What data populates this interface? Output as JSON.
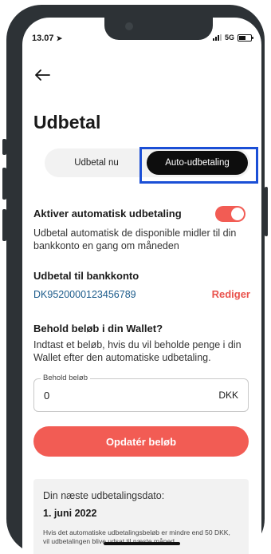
{
  "status_bar": {
    "time": "13.07",
    "network": "5G"
  },
  "page": {
    "title": "Udbetal"
  },
  "tabs": [
    {
      "label": "Udbetal nu",
      "selected": false
    },
    {
      "label": "Auto-udbetaling",
      "selected": true
    }
  ],
  "auto_payout": {
    "label": "Aktiver automatisk udbetaling",
    "enabled": true,
    "description": "Udbetal automatisk de disponible midler til din bankkonto en gang om måneden"
  },
  "bank": {
    "heading": "Udbetal til bankkonto",
    "account": "DK9520000123456789",
    "edit_label": "Rediger"
  },
  "keep": {
    "heading": "Behold beløb i din Wallet?",
    "description": "Indtast et beløb, hvis du vil beholde penge i din Wallet efter den automatiske udbetaling.",
    "field_label": "Behold beløb",
    "value": "0",
    "currency": "DKK",
    "button_label": "Opdatér beløb"
  },
  "next_payout": {
    "title": "Din næste udbetalingsdato:",
    "date": "1. juni 2022",
    "note": "Hvis det automatiske udbetalingsbeløb er mindre end 50 DKK, vil udbetalingen blive udsat til næste måned."
  },
  "colors": {
    "accent": "#f25c54",
    "highlight": "#1b4fd6",
    "selected_tab": "#0d0d0d"
  }
}
